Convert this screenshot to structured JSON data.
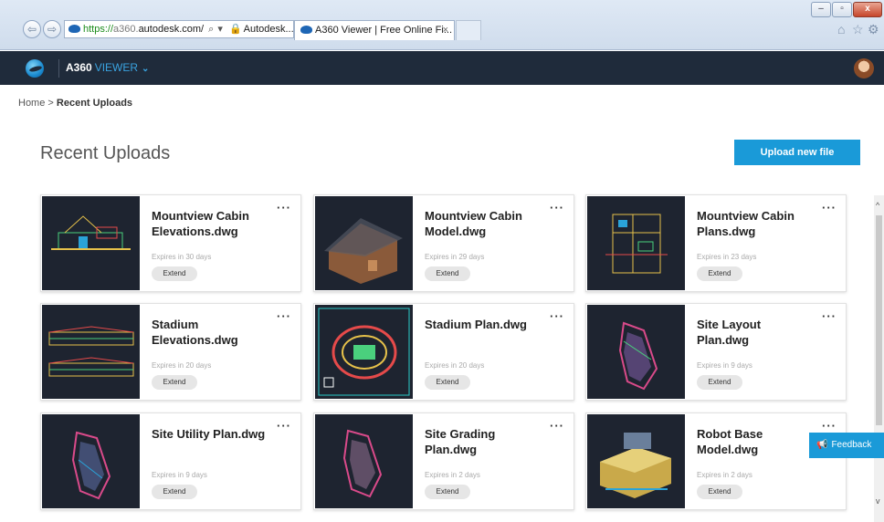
{
  "browser": {
    "address": {
      "https": "https://",
      "dim": "a360.",
      "domain": "autodesk.com/",
      "search_glyph": "⌕",
      "dropdown_glyph": "▾",
      "lock_glyph": "🔒",
      "site": "Autodesk...",
      "refresh_glyph": "C"
    },
    "tab": {
      "title": "A360 Viewer | Free Online Fi...",
      "close": "×"
    },
    "window_controls": {
      "minimize": "–",
      "maximize": "▫",
      "close": "x"
    },
    "nav": {
      "back": "⇦",
      "forward": "⇨"
    },
    "toolbar_icons": {
      "home": "⌂",
      "favorites": "☆",
      "settings": "⚙"
    }
  },
  "app": {
    "brand": "A360",
    "product": "VIEWER",
    "chevron": "⌄"
  },
  "breadcrumb": {
    "home": "Home",
    "separator": ">",
    "current": "Recent Uploads"
  },
  "page": {
    "title": "Recent Uploads",
    "upload_label": "Upload new file"
  },
  "cards": [
    {
      "name": "Mountview Cabin Elevations.dwg",
      "expires": "Expires in 30 days",
      "extend": "Extend",
      "menu": "···"
    },
    {
      "name": "Mountview Cabin Model.dwg",
      "expires": "Expires in 29 days",
      "extend": "Extend",
      "menu": "···"
    },
    {
      "name": "Mountview Cabin Plans.dwg",
      "expires": "Expires in 23 days",
      "extend": "Extend",
      "menu": "···"
    },
    {
      "name": "Stadium Elevations.dwg",
      "expires": "Expires in 20 days",
      "extend": "Extend",
      "menu": "···"
    },
    {
      "name": "Stadium Plan.dwg",
      "expires": "Expires in 20 days",
      "extend": "Extend",
      "menu": "···"
    },
    {
      "name": "Site Layout Plan.dwg",
      "expires": "Expires in 9 days",
      "extend": "Extend",
      "menu": "···"
    },
    {
      "name": "Site Utility Plan.dwg",
      "expires": "Expires in 9 days",
      "extend": "Extend",
      "menu": "···"
    },
    {
      "name": "Site Grading Plan.dwg",
      "expires": "Expires in 2 days",
      "extend": "Extend",
      "menu": "···"
    },
    {
      "name": "Robot Base Model.dwg",
      "expires": "Expires in 2 days",
      "extend": "Extend",
      "menu": "···"
    }
  ],
  "feedback": {
    "icon": "📢",
    "label": "Feedback"
  },
  "colors": {
    "header_bg": "#1f2b3b",
    "accent": "#1a9ad8",
    "thumb_bg": "#1e2430"
  }
}
